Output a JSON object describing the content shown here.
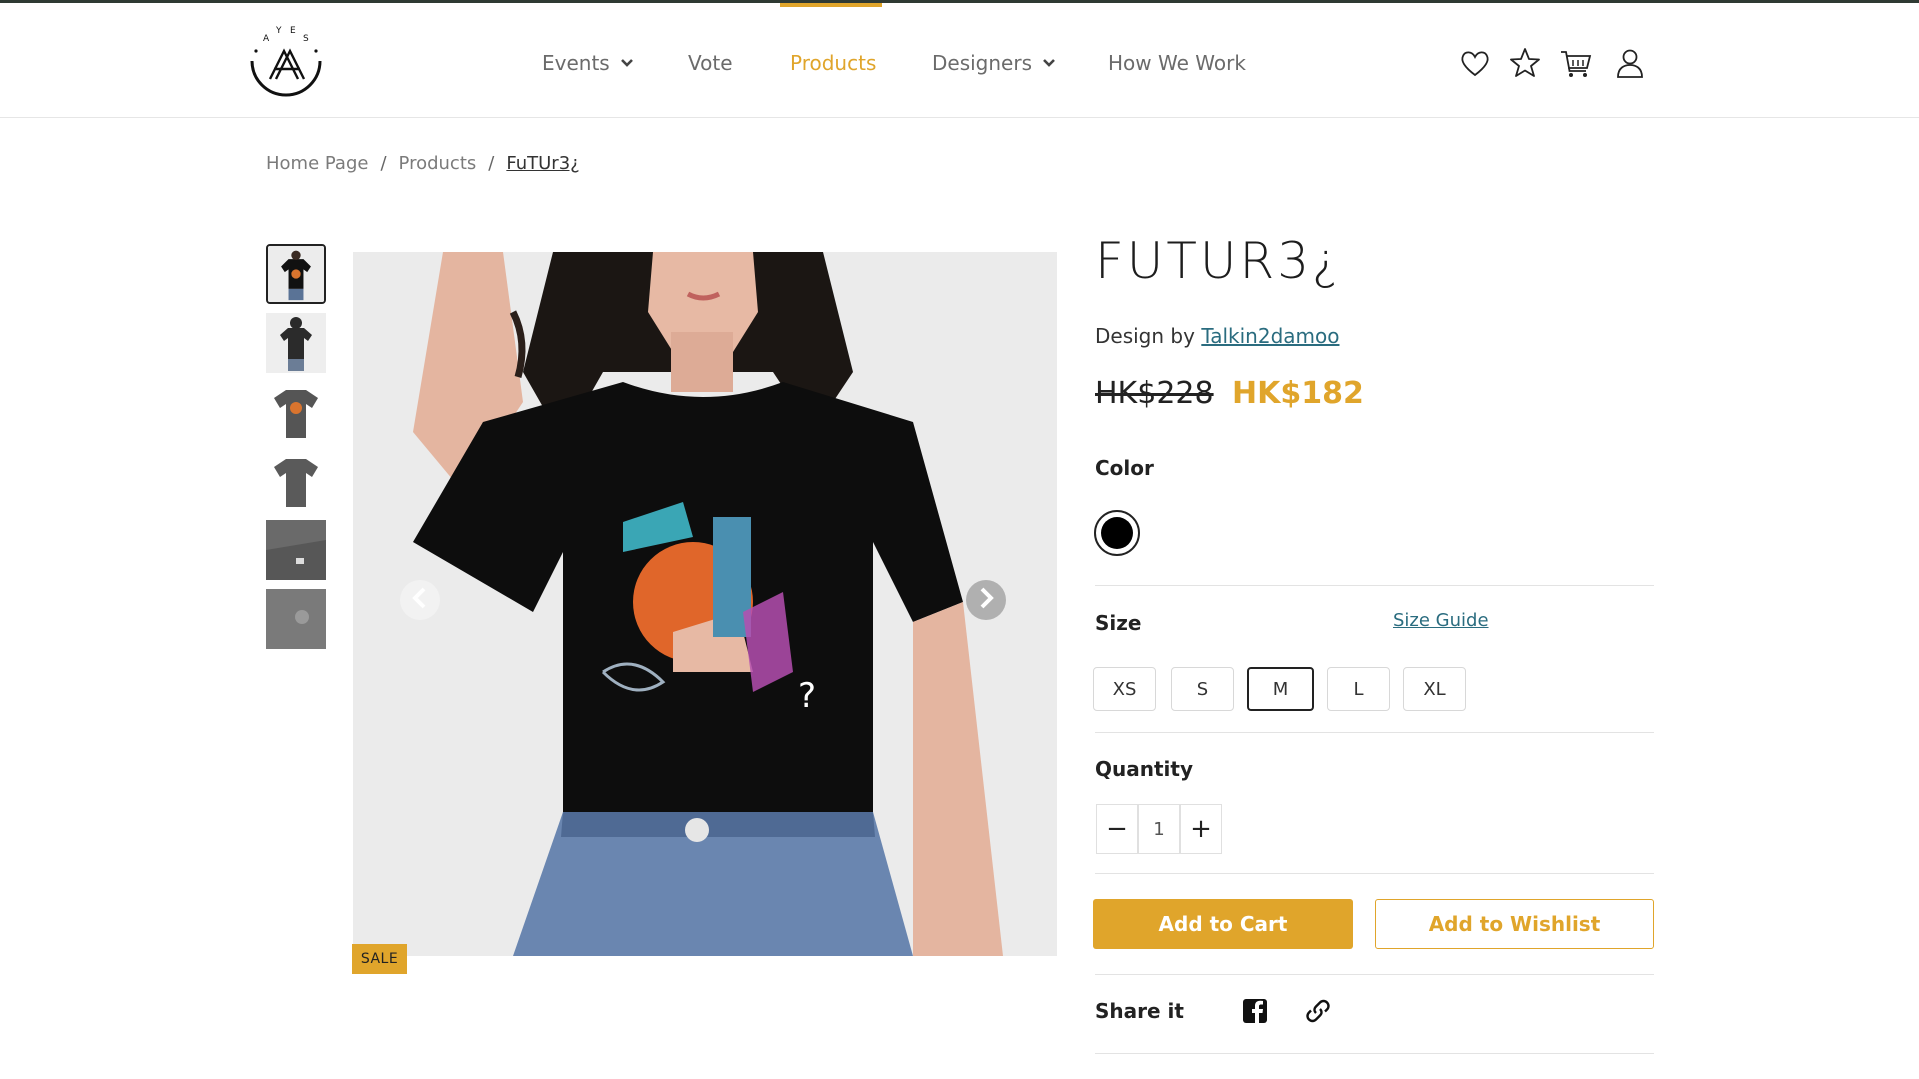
{
  "nav": {
    "items": [
      {
        "label": "Events",
        "has_dropdown": true
      },
      {
        "label": "Vote",
        "has_dropdown": false
      },
      {
        "label": "Products",
        "has_dropdown": false,
        "active": true
      },
      {
        "label": "Designers",
        "has_dropdown": true
      },
      {
        "label": "How We Work",
        "has_dropdown": false
      }
    ],
    "icons": [
      "heart-icon",
      "star-icon",
      "cart-icon",
      "user-icon"
    ],
    "logo_letters": "A Y E S",
    "accent_color": "#e0a52b"
  },
  "breadcrumb": {
    "home": "Home Page",
    "separator": "/",
    "products": "Products",
    "current": "FuTUr3¿"
  },
  "product": {
    "title": "FUTUR3¿",
    "designer_prefix": "Design by",
    "designer_name": "Talkin2damoo",
    "price_original": "HK$228",
    "price_sale": "HK$182",
    "sale_badge": "SALE",
    "color_label": "Color",
    "colors": [
      {
        "name": "black",
        "hex": "#000000",
        "selected": true
      }
    ],
    "size_label": "Size",
    "size_guide": "Size Guide",
    "sizes": [
      {
        "label": "XS",
        "selected": false
      },
      {
        "label": "S",
        "selected": false
      },
      {
        "label": "M",
        "selected": true
      },
      {
        "label": "L",
        "selected": false
      },
      {
        "label": "XL",
        "selected": false
      }
    ],
    "quantity_label": "Quantity",
    "quantity": "1",
    "qty_minus": "−",
    "qty_plus": "+",
    "add_to_cart": "Add to Cart",
    "add_to_wishlist": "Add to Wishlist",
    "share_label": "Share it",
    "thumbnail_count": 6,
    "selected_thumbnail": 1
  }
}
